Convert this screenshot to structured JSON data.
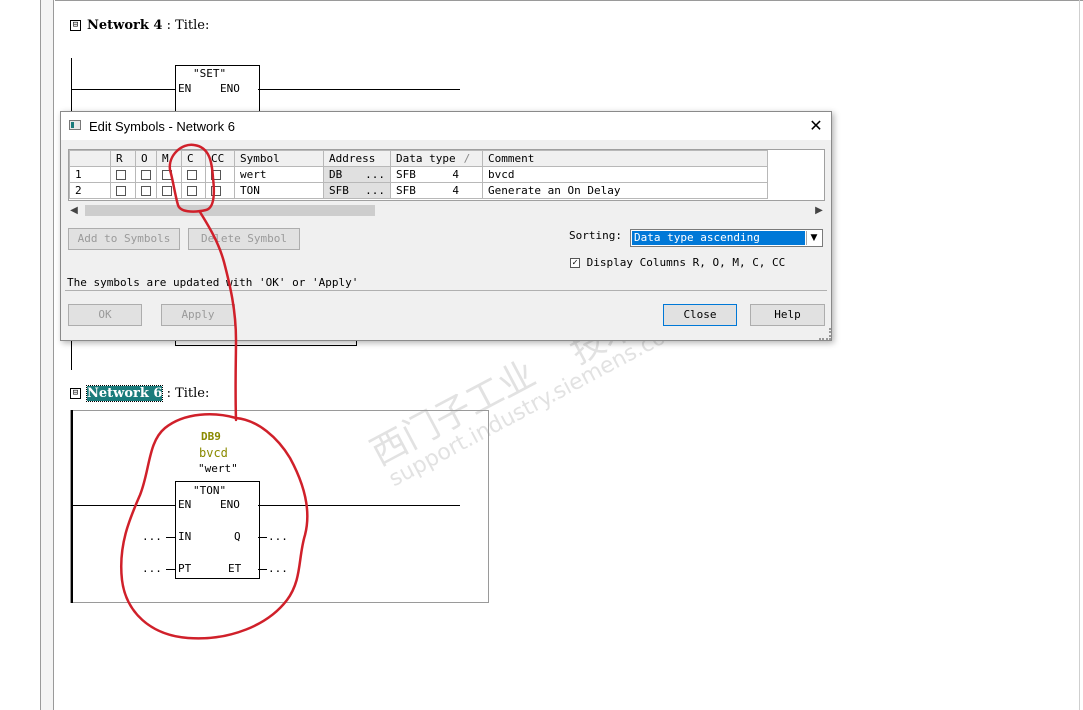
{
  "network4": {
    "title": "Network 4",
    "suffix": " : Title:",
    "collapse": "⊟",
    "block_name": "\"SET\"",
    "en": "EN",
    "eno": "ENO"
  },
  "network6": {
    "title": "Network 6",
    "suffix": " : Title:",
    "collapse": "⊟"
  },
  "hidden_block": {
    "partial_text": "...",
    "box_text": "..."
  },
  "ton_block": {
    "db": "DB9",
    "comment": "bvcd",
    "symbol": "\"wert\"",
    "name": "\"TON\"",
    "en": "EN",
    "eno": "ENO",
    "in": "IN",
    "q": "Q",
    "pt": "PT",
    "et": "ET",
    "in_value": "...",
    "pt_value": "...",
    "q_value": "...",
    "et_value": "..."
  },
  "dialog": {
    "title": "Edit Symbols - Network 6",
    "close": "✕",
    "columns": [
      "",
      "R",
      "O",
      "M",
      "C",
      "CC",
      "Symbol",
      "Address",
      "Data type",
      "Comment"
    ],
    "sort_mark": "/",
    "rows": [
      {
        "num": "1",
        "symbol": "wert",
        "address": "DB",
        "address_btn": "...",
        "data_type": "SFB",
        "data_num": "4",
        "comment": "bvcd"
      },
      {
        "num": "2",
        "symbol": "TON",
        "address": "SFB",
        "address_btn": "...",
        "data_type": "SFB",
        "data_num": "4",
        "comment": "Generate an On Delay"
      }
    ],
    "add_button": "Add to Symbols",
    "delete_button": "Delete Symbol",
    "sorting_label": "Sorting:",
    "sorting_value": "Data type ascending",
    "display_columns_label": "Display Columns R, O, M, C, CC",
    "display_columns_checked": true,
    "info_text": "The symbols are updated with 'OK' or  'Apply'",
    "ok": "OK",
    "apply": "Apply",
    "close_button": "Close",
    "help": "Help"
  },
  "watermark": {
    "line1": "西门子工业",
    "line2": "support.industry.siemens.com/cs",
    "line3": "技术论坛"
  },
  "annotation_color": "#d0202a",
  "accent": "#0078d7",
  "highlight": "#1a7b7b",
  "icons": [
    "collapse-icon",
    "dialog-app-icon",
    "close-icon",
    "scroll-left-icon",
    "scroll-right-icon",
    "dropdown-arrow-icon",
    "checkbox-icon"
  ]
}
